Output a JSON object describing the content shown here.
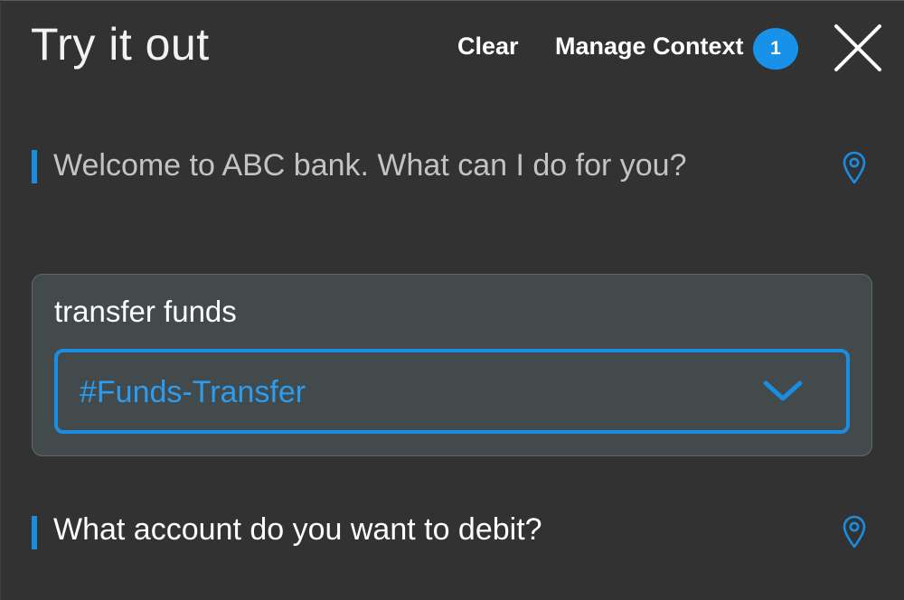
{
  "header": {
    "title": "Try it out",
    "clear_label": "Clear",
    "manage_context_label": "Manage Context",
    "context_count": "1"
  },
  "messages": [
    {
      "text": "Welcome to ABC bank. What can I do for you?",
      "icon": "location-pin-icon"
    },
    {
      "text": "What account do you want to debit?",
      "icon": "location-pin-icon"
    }
  ],
  "user_input": {
    "text": "transfer funds",
    "intent_selected": "#Funds-Transfer"
  },
  "colors": {
    "background": "#323232",
    "accent": "#1a8de0",
    "badge": "#1892e8",
    "card": "#434a4b"
  }
}
